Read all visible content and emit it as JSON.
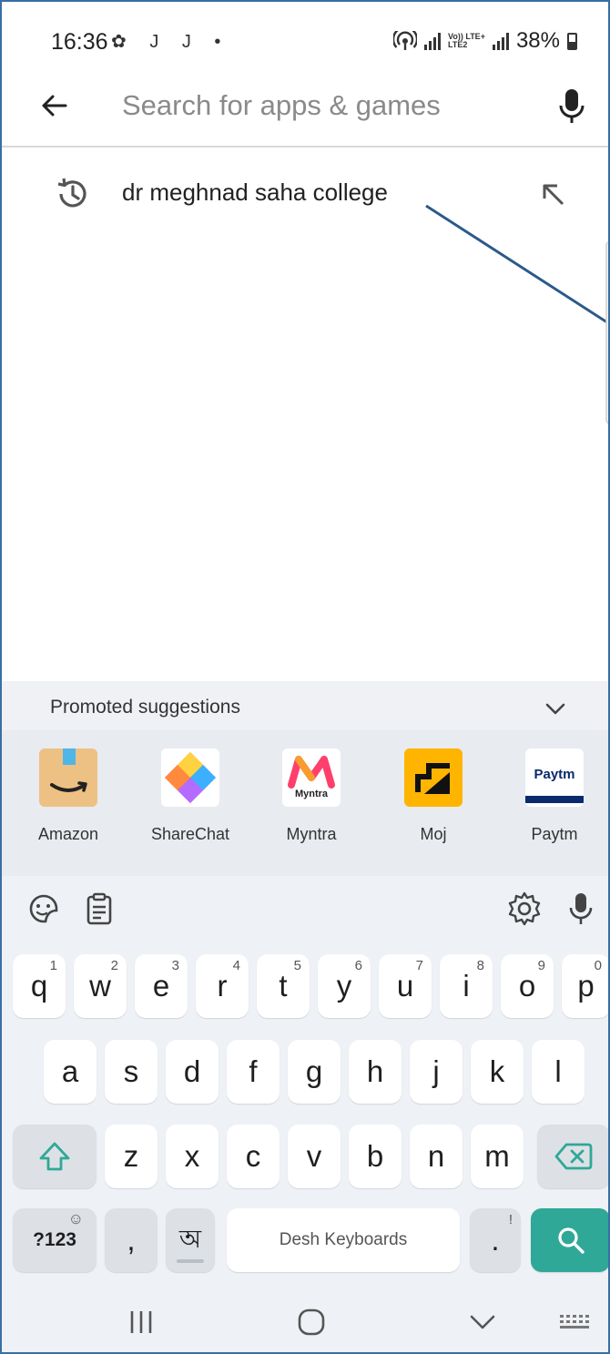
{
  "status_bar": {
    "time": "16:36",
    "left_icons": [
      "settings-flower-icon",
      "j-icon",
      "j-icon",
      "dot-icon"
    ],
    "left_icons_text": "✿ J J •",
    "lte_top": "Vo)) LTE+",
    "lte_bottom": "LTE2",
    "battery": "38%"
  },
  "search": {
    "placeholder": "Search for apps & games",
    "value": ""
  },
  "history": [
    {
      "text": "dr meghnad saha college"
    }
  ],
  "promoted": {
    "title": "Promoted suggestions",
    "apps": [
      {
        "name": "Amazon"
      },
      {
        "name": "ShareChat"
      },
      {
        "name": "Myntra",
        "icon_text": "Myntra"
      },
      {
        "name": "Moj"
      },
      {
        "name": "Paytm",
        "icon_text": "Paytm"
      }
    ]
  },
  "keyboard": {
    "row1": [
      {
        "k": "q",
        "h": "1"
      },
      {
        "k": "w",
        "h": "2"
      },
      {
        "k": "e",
        "h": "3"
      },
      {
        "k": "r",
        "h": "4"
      },
      {
        "k": "t",
        "h": "5"
      },
      {
        "k": "y",
        "h": "6"
      },
      {
        "k": "u",
        "h": "7"
      },
      {
        "k": "i",
        "h": "8"
      },
      {
        "k": "o",
        "h": "9"
      },
      {
        "k": "p",
        "h": "0"
      }
    ],
    "row2": [
      "a",
      "s",
      "d",
      "f",
      "g",
      "h",
      "j",
      "k",
      "l"
    ],
    "row3": [
      "z",
      "x",
      "c",
      "v",
      "b",
      "n",
      "m"
    ],
    "symbols": "?123",
    "symbols_hint": "☺",
    "comma": ",",
    "bengali": "অ",
    "space": "Desh Keyboards",
    "period": ".",
    "period_hint": "!"
  },
  "colors": {
    "accent": "#2fa897",
    "frame": "#3a6ea5",
    "annotation_line": "#2b5a8a"
  }
}
